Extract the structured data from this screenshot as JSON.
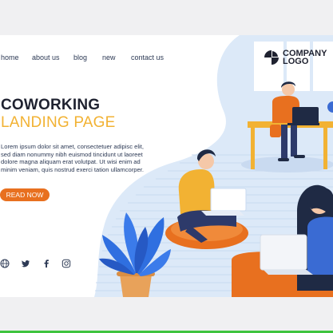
{
  "nav": {
    "items": [
      {
        "label": "home"
      },
      {
        "label": "about us"
      },
      {
        "label": "blog"
      },
      {
        "label": "new"
      },
      {
        "label": "contact us"
      }
    ]
  },
  "logo": {
    "line1": "COMPANY",
    "line2": "LOGO",
    "icon": "logo-mark-icon"
  },
  "hero": {
    "title_line1": "COWORKING",
    "title_line2": "LANDING PAGE",
    "body": "Lorem ipsum dolor sit amet, consectetuer adipisc elit, sed diam nonummy nibh euismod tincidunt ut laoreet dolore magna aliquam erat volutpat. Ut wisi enim ad minim veniam, quis nostrud exerci tation ullamcorper.",
    "cta_label": "READ NOW"
  },
  "social": [
    "globe-icon",
    "twitter-icon",
    "facebook-icon",
    "instagram-icon"
  ],
  "colors": {
    "accent_orange": "#e8701f",
    "accent_yellow": "#f2b233",
    "light_blue": "#dce9f8",
    "dark_text": "#1f2230",
    "plant_blue": "#2f6fe0"
  }
}
